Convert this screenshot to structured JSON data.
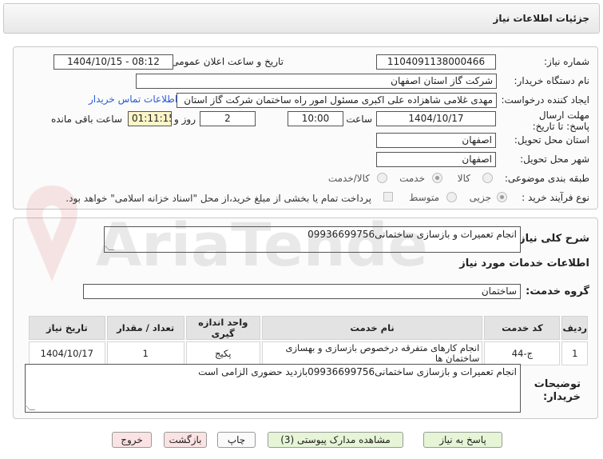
{
  "header": {
    "title": "جزئیات اطلاعات نیاز"
  },
  "form": {
    "need_number_label": "شماره نیاز:",
    "need_number": "1104091138000466",
    "announce_label": "تاریخ و ساعت اعلان عمومی:",
    "announce_value": "1404/10/15 - 08:12",
    "buyer_org_label": "نام دستگاه خریدار:",
    "buyer_org": "شرکت گاز استان اصفهان",
    "creator_label": "ایجاد کننده درخواست:",
    "creator": "مهدی غلامی شاهزاده علی اکبری مسئول امور راه ساختمان شرکت گاز استان",
    "contact_link": "اطلاعات تماس خریدار",
    "deadline_label": "مهلت ارسال پاسخ: تا تاریخ:",
    "deadline_date": "1404/10/17",
    "hour_label": "ساعت",
    "deadline_time": "10:00",
    "days_value": "2",
    "days_label": "روز و",
    "remaining_value": "01:11:15",
    "remaining_label": "ساعت باقی مانده",
    "province_label": "استان محل تحویل:",
    "province": "اصفهان",
    "city_label": "شهر محل تحویل:",
    "city": "اصفهان",
    "category_label": "طبقه بندی موضوعی:",
    "category_options": [
      "کالا",
      "خدمت",
      "کالا/خدمت"
    ],
    "category_selected": "خدمت",
    "process_label": "نوع فرآیند خرید :",
    "process_options": [
      "جزیی",
      "متوسط"
    ],
    "payment_note": "پرداخت تمام یا بخشی از مبلغ خرید،از محل \"اسناد خزانه اسلامی\" خواهد بود."
  },
  "details": {
    "summary_label": "شرح کلی نیاز:",
    "summary": "انجام تعمیرات و بازسازی ساختمانی09936699756",
    "services_title": "اطلاعات خدمات مورد نیاز",
    "service_group_label": "گروه خدمت:",
    "service_group": "ساختمان",
    "table": {
      "headers": [
        "ردیف",
        "کد خدمت",
        "نام خدمت",
        "واحد اندازه گیری",
        "تعداد / مقدار",
        "تاریخ نیاز"
      ],
      "rows": [
        [
          "1",
          "ج-44",
          "انجام کارهای متفرقه درخصوص بازسازی و بهسازی ساختمان ها",
          "پکیج",
          "1",
          "1404/10/17"
        ]
      ]
    },
    "notes_label": "توضیحات خریدار:",
    "notes": "انجام تعمیرات و بازسازی ساختمانی09936699756بازدید حضوری الزامی است"
  },
  "buttons": {
    "reply": "پاسخ به نیاز",
    "attachments": "مشاهده مدارک پیوستی (3)",
    "print": "چاپ",
    "back": "بازگشت",
    "exit": "خروج"
  },
  "watermark": {
    "text": "AriaTender.neT"
  }
}
